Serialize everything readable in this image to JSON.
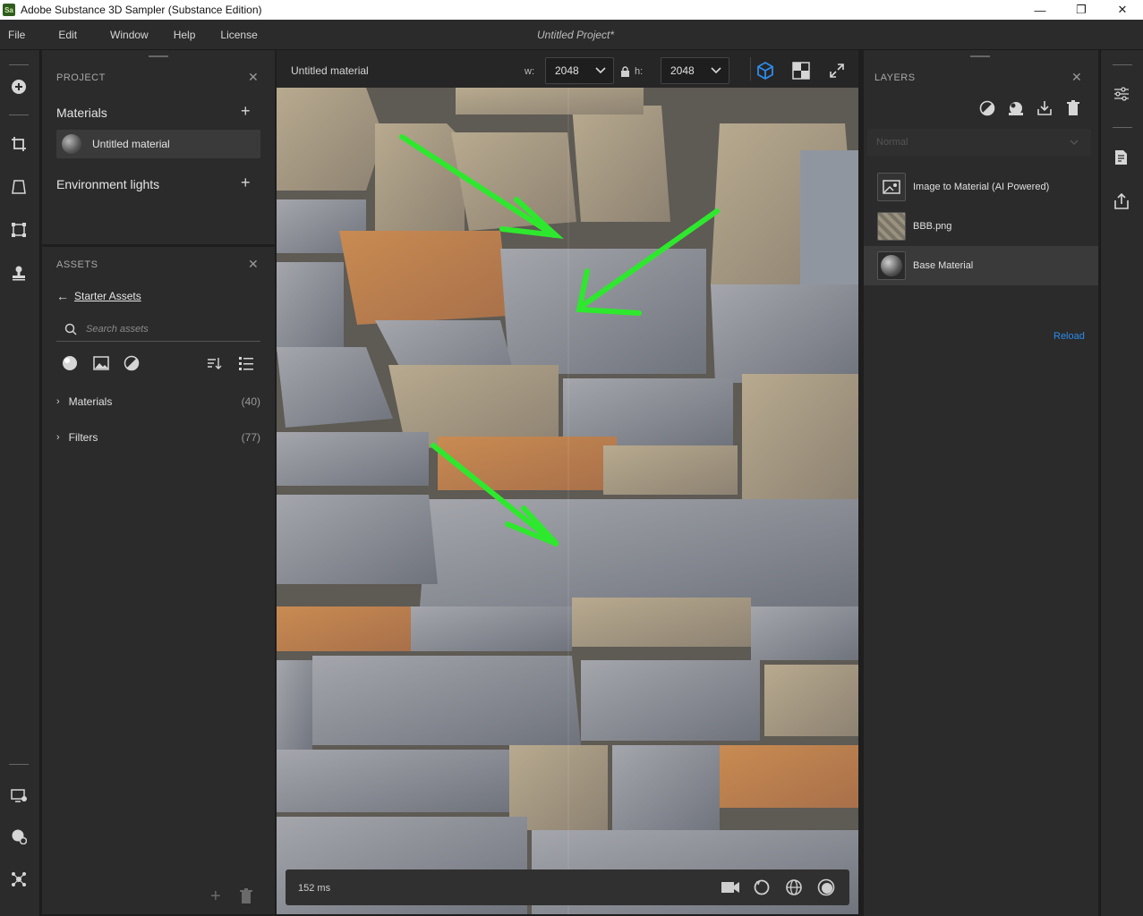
{
  "window": {
    "title": "Adobe Substance 3D Sampler (Substance Edition)",
    "app_icon": "Sa",
    "minimize": "—",
    "maximize": "❐",
    "close": "✕"
  },
  "menu": [
    "File",
    "Edit",
    "Window",
    "Help",
    "License"
  ],
  "project_title": "Untitled Project*",
  "project_panel": {
    "header": "PROJECT",
    "materials_label": "Materials",
    "material_item": "Untitled material",
    "env_label": "Environment lights"
  },
  "assets_panel": {
    "header": "ASSETS",
    "back_label": "Starter Assets",
    "search_placeholder": "Search assets",
    "items": [
      {
        "label": "Materials",
        "count": "(40)"
      },
      {
        "label": "Filters",
        "count": "(77)"
      }
    ]
  },
  "viewport": {
    "material_name": "Untitled material",
    "w_label": "w:",
    "w_value": "2048",
    "h_label": "h:",
    "h_value": "2048",
    "timing": "152 ms"
  },
  "layers_panel": {
    "header": "LAYERS",
    "blend_mode": "Normal",
    "layers": [
      {
        "name": "Image to Material (AI Powered)"
      },
      {
        "name": "BBB.png"
      },
      {
        "name": "Base Material"
      }
    ],
    "reload": "Reload"
  },
  "colors": {
    "accent": "#2d8ceb",
    "selected_layer": "#3a3a3a",
    "annotation_arrow": "#2ee82e"
  }
}
